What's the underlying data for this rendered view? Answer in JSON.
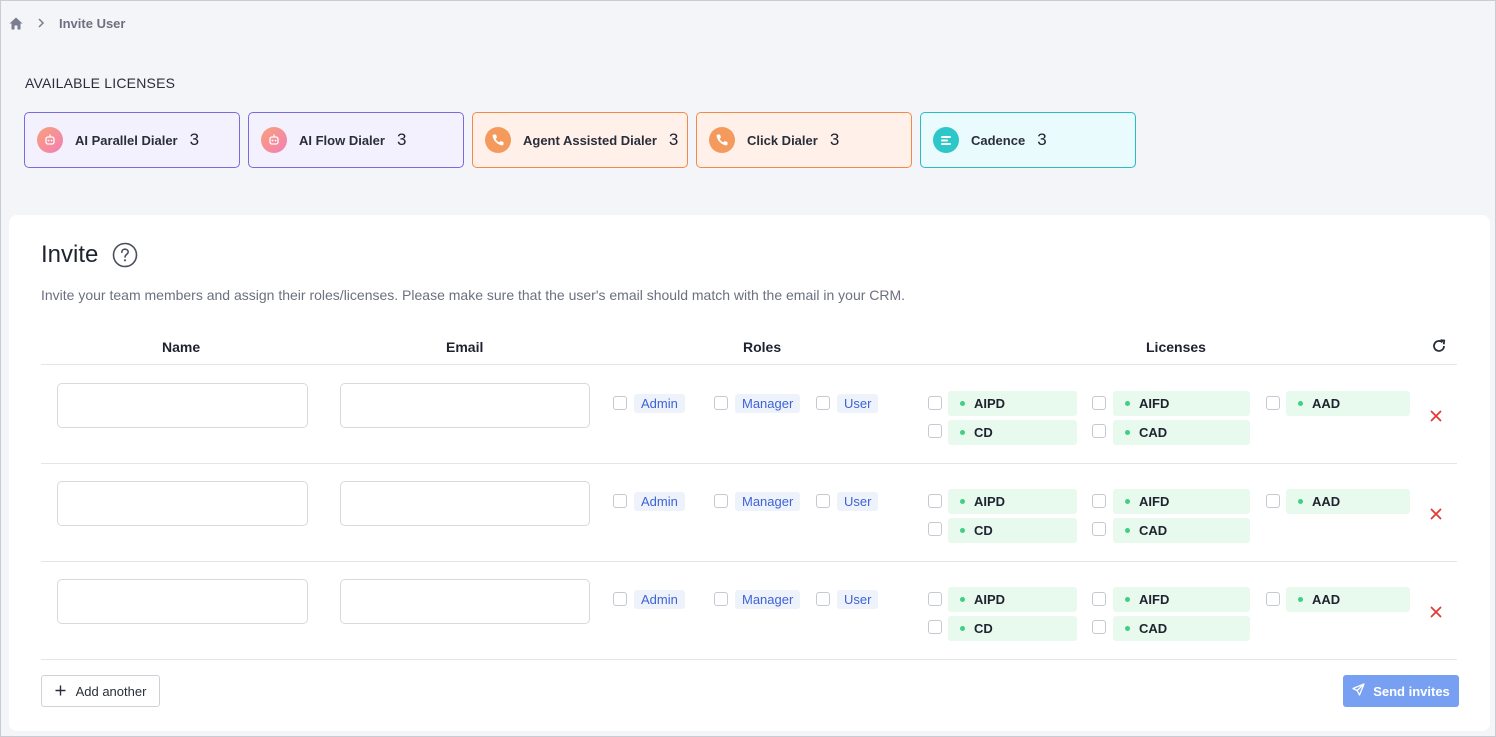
{
  "breadcrumb": {
    "current": "Invite User"
  },
  "licenses_section": {
    "heading": "AVAILABLE LICENSES",
    "cards": [
      {
        "name": "AI Parallel Dialer",
        "count": "3",
        "icon": "robot-icon",
        "theme": "purple"
      },
      {
        "name": "AI Flow Dialer",
        "count": "3",
        "icon": "robot-icon",
        "theme": "purple"
      },
      {
        "name": "Agent Assisted Dialer",
        "count": "3",
        "icon": "phone-icon",
        "theme": "orange"
      },
      {
        "name": "Click Dialer",
        "count": "3",
        "icon": "phone-icon",
        "theme": "orange"
      },
      {
        "name": "Cadence",
        "count": "3",
        "icon": "cadence-icon",
        "theme": "teal"
      }
    ]
  },
  "invite": {
    "title": "Invite",
    "description": "Invite your team members and assign their roles/licenses. Please make sure that the user's email should match with the email in your CRM.",
    "columns": {
      "name": "Name",
      "email": "Email",
      "roles": "Roles",
      "licenses": "Licenses"
    },
    "rows": [
      {
        "name": "",
        "email": "",
        "roles": [
          "Admin",
          "Manager",
          "User"
        ],
        "licenses": [
          "AIPD",
          "AIFD",
          "AAD",
          "CD",
          "CAD"
        ]
      },
      {
        "name": "",
        "email": "",
        "roles": [
          "Admin",
          "Manager",
          "User"
        ],
        "licenses": [
          "AIPD",
          "AIFD",
          "AAD",
          "CD",
          "CAD"
        ]
      },
      {
        "name": "",
        "email": "",
        "roles": [
          "Admin",
          "Manager",
          "User"
        ],
        "licenses": [
          "AIPD",
          "AIFD",
          "AAD",
          "CD",
          "CAD"
        ]
      }
    ],
    "add_another_label": "Add another",
    "send_label": "Send invites"
  },
  "colors": {
    "accent_blue": "#3d63d6",
    "send_button": "#77a0f2",
    "remove_red": "#e53935",
    "license_dot": "#3fd083"
  }
}
